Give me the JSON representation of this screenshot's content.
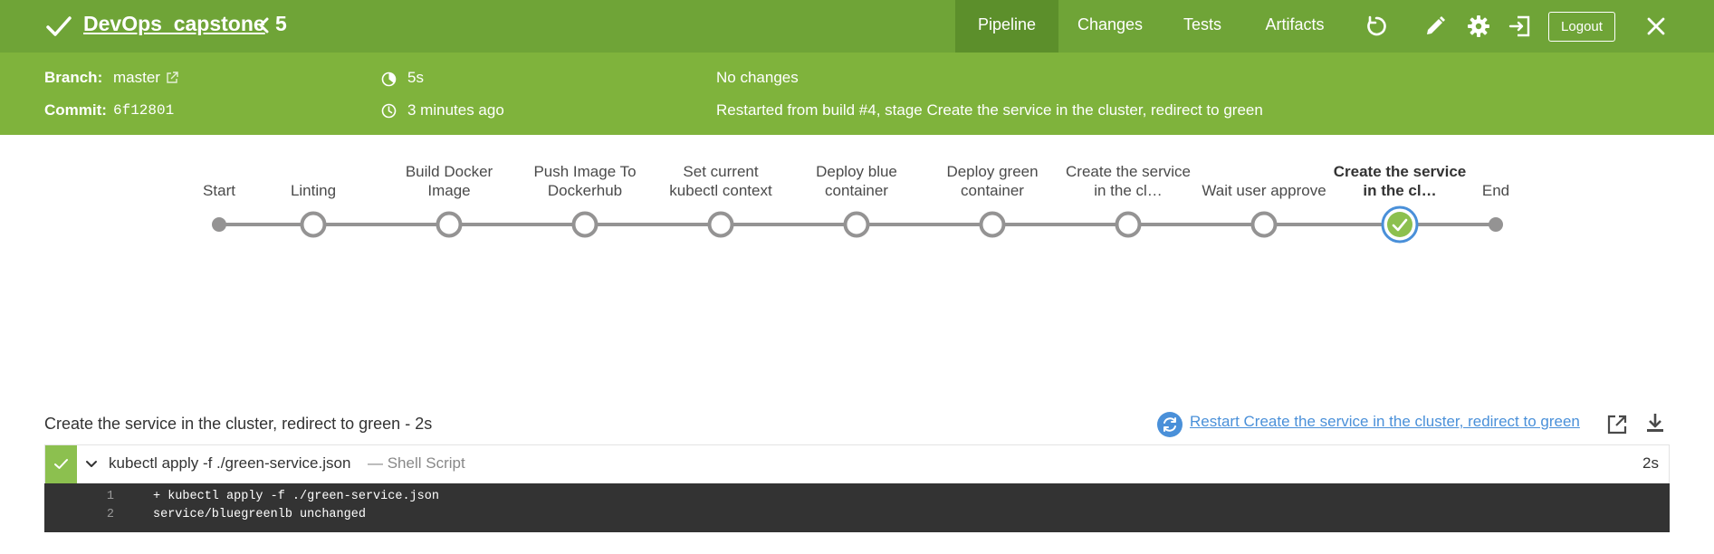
{
  "header": {
    "job_title": "DevOps_capstone",
    "run_number": "5",
    "tabs": [
      {
        "label": "Pipeline",
        "active": true
      },
      {
        "label": "Changes",
        "active": false
      },
      {
        "label": "Tests",
        "active": false
      },
      {
        "label": "Artifacts",
        "active": false
      }
    ],
    "logout_label": "Logout",
    "icons": [
      "check-icon",
      "back-chevron-icon",
      "replay-icon",
      "edit-icon",
      "gear-icon",
      "exit-icon",
      "close-icon"
    ],
    "colors": {
      "topbar": "#6fa437",
      "infobar": "#7fb33c",
      "active_tab": "#5c8f2b"
    }
  },
  "run_info": {
    "branch_label": "Branch:",
    "branch": "master",
    "commit_label": "Commit:",
    "commit": "6f12801",
    "duration": "5s",
    "started": "3 minutes ago",
    "changes": "No changes",
    "cause": "Restarted from build #4, stage Create the service in the cluster, redirect to green"
  },
  "pipeline": {
    "stages": [
      {
        "label": [
          "Start"
        ],
        "kind": "start"
      },
      {
        "label": [
          "Linting"
        ],
        "kind": "stage"
      },
      {
        "label": [
          "Build Docker",
          "Image"
        ],
        "kind": "stage"
      },
      {
        "label": [
          "Push Image To",
          "Dockerhub"
        ],
        "kind": "stage"
      },
      {
        "label": [
          "Set current",
          "kubectl context"
        ],
        "kind": "stage"
      },
      {
        "label": [
          "Deploy blue",
          "container"
        ],
        "kind": "stage"
      },
      {
        "label": [
          "Deploy green",
          "container"
        ],
        "kind": "stage"
      },
      {
        "label": [
          "Create the service",
          "in the cl…"
        ],
        "kind": "stage"
      },
      {
        "label": [
          "Wait user approve"
        ],
        "kind": "stage"
      },
      {
        "label": [
          "Create the service",
          "in the cl…"
        ],
        "kind": "success",
        "selected": true
      },
      {
        "label": [
          "End"
        ],
        "kind": "end"
      }
    ],
    "colors": {
      "line": "#949393",
      "success": "#8cc04f",
      "selected_ring": "#4a90d9"
    }
  },
  "step_detail": {
    "title": "Create the service in the cluster, redirect to green - 2s",
    "restart_label": "Restart Create the service in the cluster, redirect to green",
    "steps": [
      {
        "command": "kubectl apply -f ./green-service.json",
        "type": "— Shell Script",
        "duration": "2s",
        "log": [
          {
            "num": "1",
            "text": "+ kubectl apply -f ./green-service.json"
          },
          {
            "num": "2",
            "text": "service/bluegreenlb unchanged"
          }
        ]
      }
    ]
  }
}
